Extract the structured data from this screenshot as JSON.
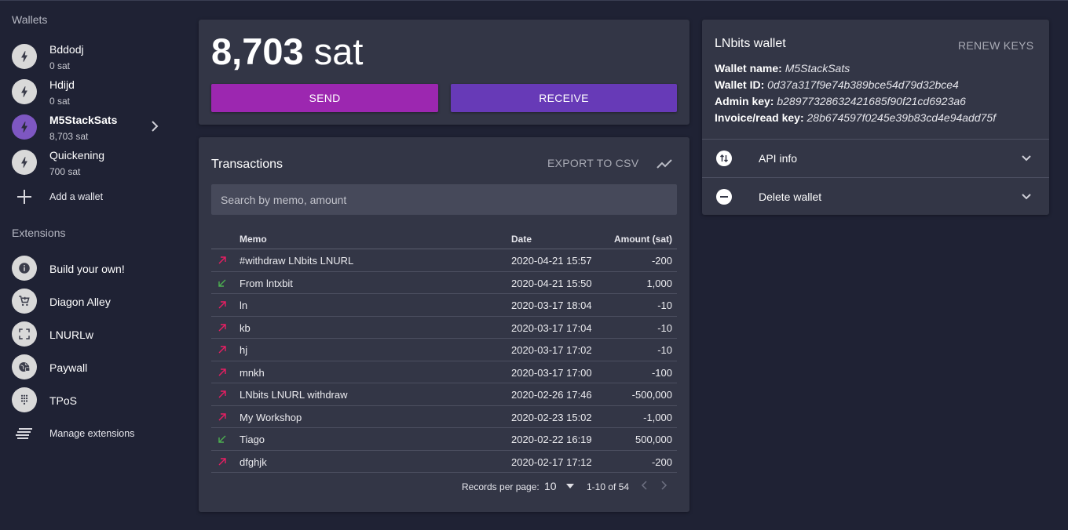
{
  "sidebar": {
    "wallets_title": "Wallets",
    "wallets": [
      {
        "name": "Bddodj",
        "balance": "0 sat",
        "icon": "bolt-icon"
      },
      {
        "name": "Hdijd",
        "balance": "0 sat",
        "icon": "bolt-icon"
      },
      {
        "name": "M5StackSats",
        "balance": "8,703 sat",
        "icon": "bolt-icon",
        "active": true
      },
      {
        "name": "Quickening",
        "balance": "700 sat",
        "icon": "bolt-icon"
      }
    ],
    "add_wallet_label": "Add a wallet",
    "extensions_title": "Extensions",
    "extensions": [
      {
        "label": "Build your own!",
        "icon": "info-icon"
      },
      {
        "label": "Diagon Alley",
        "icon": "cart-icon"
      },
      {
        "label": "LNURLw",
        "icon": "scan-icon"
      },
      {
        "label": "Paywall",
        "icon": "globe-lock-icon"
      },
      {
        "label": "TPoS",
        "icon": "dialpad-icon"
      }
    ],
    "manage_label": "Manage extensions"
  },
  "balance": {
    "amount": "8,703",
    "unit": "sat",
    "send_label": "SEND",
    "receive_label": "RECEIVE"
  },
  "transactions": {
    "title": "Transactions",
    "export_label": "EXPORT TO CSV",
    "search_placeholder": "Search by memo, amount",
    "headers": {
      "memo": "Memo",
      "date": "Date",
      "amount": "Amount (sat)"
    },
    "rows": [
      {
        "dir": "out",
        "memo": "#withdraw LNbits LNURL",
        "date": "2020-04-21 15:57",
        "amount": "-200"
      },
      {
        "dir": "in",
        "memo": "From lntxbit",
        "date": "2020-04-21 15:50",
        "amount": "1,000"
      },
      {
        "dir": "out",
        "memo": "ln",
        "date": "2020-03-17 18:04",
        "amount": "-10"
      },
      {
        "dir": "out",
        "memo": "kb",
        "date": "2020-03-17 17:04",
        "amount": "-10"
      },
      {
        "dir": "out",
        "memo": "hj",
        "date": "2020-03-17 17:02",
        "amount": "-10"
      },
      {
        "dir": "out",
        "memo": "mnkh",
        "date": "2020-03-17 17:00",
        "amount": "-100"
      },
      {
        "dir": "out",
        "memo": "LNbits LNURL withdraw",
        "date": "2020-02-26 17:46",
        "amount": "-500,000"
      },
      {
        "dir": "out",
        "memo": "My Workshop",
        "date": "2020-02-23 15:02",
        "amount": "-1,000"
      },
      {
        "dir": "in",
        "memo": "Tiago",
        "date": "2020-02-22 16:19",
        "amount": "500,000"
      },
      {
        "dir": "out",
        "memo": "dfghjk",
        "date": "2020-02-17 17:12",
        "amount": "-200"
      }
    ],
    "pagination": {
      "records_label": "Records per page:",
      "per_page": "10",
      "range": "1-10 of 54"
    }
  },
  "wallet_info": {
    "title": "LNbits wallet",
    "renew_label": "RENEW KEYS",
    "fields": [
      {
        "label": "Wallet name:",
        "value": "M5StackSats"
      },
      {
        "label": "Wallet ID:",
        "value": "0d37a317f9e74b389bce54d79d32bce4"
      },
      {
        "label": "Admin key:",
        "value": "b28977328632421685f90f21cd6923a6"
      },
      {
        "label": "Invoice/read key:",
        "value": "28b674597f0245e39b83cd4e94add75f"
      }
    ],
    "api_info_label": "API info",
    "delete_label": "Delete wallet"
  },
  "colors": {
    "background": "#1f2234",
    "card": "#333646",
    "send": "#9c27b0",
    "receive": "#673ab7",
    "outgoing_arrow": "#e91e63",
    "incoming_arrow": "#4caf50"
  }
}
